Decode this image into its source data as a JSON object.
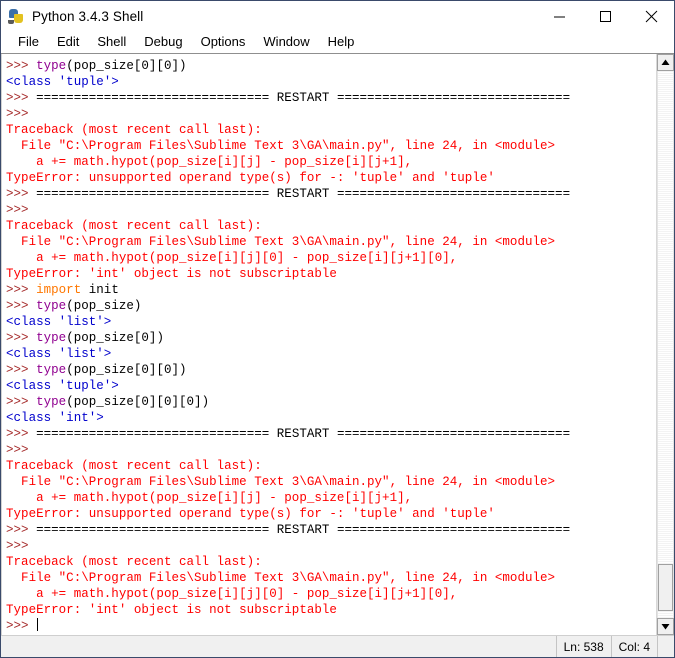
{
  "window": {
    "title": "Python 3.4.3 Shell",
    "icon": "python-logo-icon",
    "controls": {
      "minimize": "minimize-icon",
      "maximize": "maximize-icon",
      "close": "close-icon"
    }
  },
  "menubar": {
    "items": [
      {
        "label": "File"
      },
      {
        "label": "Edit"
      },
      {
        "label": "Shell"
      },
      {
        "label": "Debug"
      },
      {
        "label": "Options"
      },
      {
        "label": "Window"
      },
      {
        "label": "Help"
      }
    ]
  },
  "colors": {
    "prompt": "#a52a2a",
    "output": "#0000cc",
    "error": "#ff0000",
    "keyword": "#ff7700",
    "builtin": "#900090",
    "plain": "#000000",
    "background": "#ffffff"
  },
  "shell": {
    "lines": [
      {
        "segments": [
          {
            "text": ">>> ",
            "cls": "tok-prompt"
          },
          {
            "text": "type",
            "cls": "tok-builtin"
          },
          {
            "text": "(pop_size[0][0])",
            "cls": "tok-plain"
          }
        ]
      },
      {
        "segments": [
          {
            "text": "<class 'tuple'>",
            "cls": "tok-out"
          }
        ]
      },
      {
        "segments": [
          {
            "text": ">>> ",
            "cls": "tok-prompt"
          },
          {
            "text": "=============================== RESTART ===============================",
            "cls": "tok-plain"
          }
        ]
      },
      {
        "segments": [
          {
            "text": ">>> ",
            "cls": "tok-prompt"
          }
        ]
      },
      {
        "segments": [
          {
            "text": "Traceback (most recent call last):",
            "cls": "tok-err"
          }
        ]
      },
      {
        "segments": [
          {
            "text": "  File \"C:\\Program Files\\Sublime Text 3\\GA\\main.py\", line 24, in <module>",
            "cls": "tok-err"
          }
        ]
      },
      {
        "segments": [
          {
            "text": "    a += math.hypot(pop_size[i][j] - pop_size[i][j+1],",
            "cls": "tok-err"
          }
        ]
      },
      {
        "segments": [
          {
            "text": "TypeError: unsupported operand type(s) for -: 'tuple' and 'tuple'",
            "cls": "tok-err"
          }
        ]
      },
      {
        "segments": [
          {
            "text": ">>> ",
            "cls": "tok-prompt"
          },
          {
            "text": "=============================== RESTART ===============================",
            "cls": "tok-plain"
          }
        ]
      },
      {
        "segments": [
          {
            "text": ">>> ",
            "cls": "tok-prompt"
          }
        ]
      },
      {
        "segments": [
          {
            "text": "Traceback (most recent call last):",
            "cls": "tok-err"
          }
        ]
      },
      {
        "segments": [
          {
            "text": "  File \"C:\\Program Files\\Sublime Text 3\\GA\\main.py\", line 24, in <module>",
            "cls": "tok-err"
          }
        ]
      },
      {
        "segments": [
          {
            "text": "    a += math.hypot(pop_size[i][j][0] - pop_size[i][j+1][0],",
            "cls": "tok-err"
          }
        ]
      },
      {
        "segments": [
          {
            "text": "TypeError: 'int' object is not subscriptable",
            "cls": "tok-err"
          }
        ]
      },
      {
        "segments": [
          {
            "text": ">>> ",
            "cls": "tok-prompt"
          },
          {
            "text": "import",
            "cls": "tok-kw"
          },
          {
            "text": " init",
            "cls": "tok-plain"
          }
        ]
      },
      {
        "segments": [
          {
            "text": ">>> ",
            "cls": "tok-prompt"
          },
          {
            "text": "type",
            "cls": "tok-builtin"
          },
          {
            "text": "(pop_size)",
            "cls": "tok-plain"
          }
        ]
      },
      {
        "segments": [
          {
            "text": "<class 'list'>",
            "cls": "tok-out"
          }
        ]
      },
      {
        "segments": [
          {
            "text": ">>> ",
            "cls": "tok-prompt"
          },
          {
            "text": "type",
            "cls": "tok-builtin"
          },
          {
            "text": "(pop_size[0])",
            "cls": "tok-plain"
          }
        ]
      },
      {
        "segments": [
          {
            "text": "<class 'list'>",
            "cls": "tok-out"
          }
        ]
      },
      {
        "segments": [
          {
            "text": ">>> ",
            "cls": "tok-prompt"
          },
          {
            "text": "type",
            "cls": "tok-builtin"
          },
          {
            "text": "(pop_size[0][0])",
            "cls": "tok-plain"
          }
        ]
      },
      {
        "segments": [
          {
            "text": "<class 'tuple'>",
            "cls": "tok-out"
          }
        ]
      },
      {
        "segments": [
          {
            "text": ">>> ",
            "cls": "tok-prompt"
          },
          {
            "text": "type",
            "cls": "tok-builtin"
          },
          {
            "text": "(pop_size[0][0][0])",
            "cls": "tok-plain"
          }
        ]
      },
      {
        "segments": [
          {
            "text": "<class 'int'>",
            "cls": "tok-out"
          }
        ]
      },
      {
        "segments": [
          {
            "text": ">>> ",
            "cls": "tok-prompt"
          },
          {
            "text": "=============================== RESTART ===============================",
            "cls": "tok-plain"
          }
        ]
      },
      {
        "segments": [
          {
            "text": ">>> ",
            "cls": "tok-prompt"
          }
        ]
      },
      {
        "segments": [
          {
            "text": "Traceback (most recent call last):",
            "cls": "tok-err"
          }
        ]
      },
      {
        "segments": [
          {
            "text": "  File \"C:\\Program Files\\Sublime Text 3\\GA\\main.py\", line 24, in <module>",
            "cls": "tok-err"
          }
        ]
      },
      {
        "segments": [
          {
            "text": "    a += math.hypot(pop_size[i][j] - pop_size[i][j+1],",
            "cls": "tok-err"
          }
        ]
      },
      {
        "segments": [
          {
            "text": "TypeError: unsupported operand type(s) for -: 'tuple' and 'tuple'",
            "cls": "tok-err"
          }
        ]
      },
      {
        "segments": [
          {
            "text": ">>> ",
            "cls": "tok-prompt"
          },
          {
            "text": "=============================== RESTART ===============================",
            "cls": "tok-plain"
          }
        ]
      },
      {
        "segments": [
          {
            "text": ">>> ",
            "cls": "tok-prompt"
          }
        ]
      },
      {
        "segments": [
          {
            "text": "Traceback (most recent call last):",
            "cls": "tok-err"
          }
        ]
      },
      {
        "segments": [
          {
            "text": "  File \"C:\\Program Files\\Sublime Text 3\\GA\\main.py\", line 24, in <module>",
            "cls": "tok-err"
          }
        ]
      },
      {
        "segments": [
          {
            "text": "    a += math.hypot(pop_size[i][j][0] - pop_size[i][j+1][0],",
            "cls": "tok-err"
          }
        ]
      },
      {
        "segments": [
          {
            "text": "TypeError: 'int' object is not subscriptable",
            "cls": "tok-err"
          }
        ]
      },
      {
        "segments": [
          {
            "text": ">>> ",
            "cls": "tok-prompt"
          }
        ],
        "caret": true
      }
    ]
  },
  "statusbar": {
    "line_label": "Ln: 538",
    "col_label": "Col: 4"
  }
}
